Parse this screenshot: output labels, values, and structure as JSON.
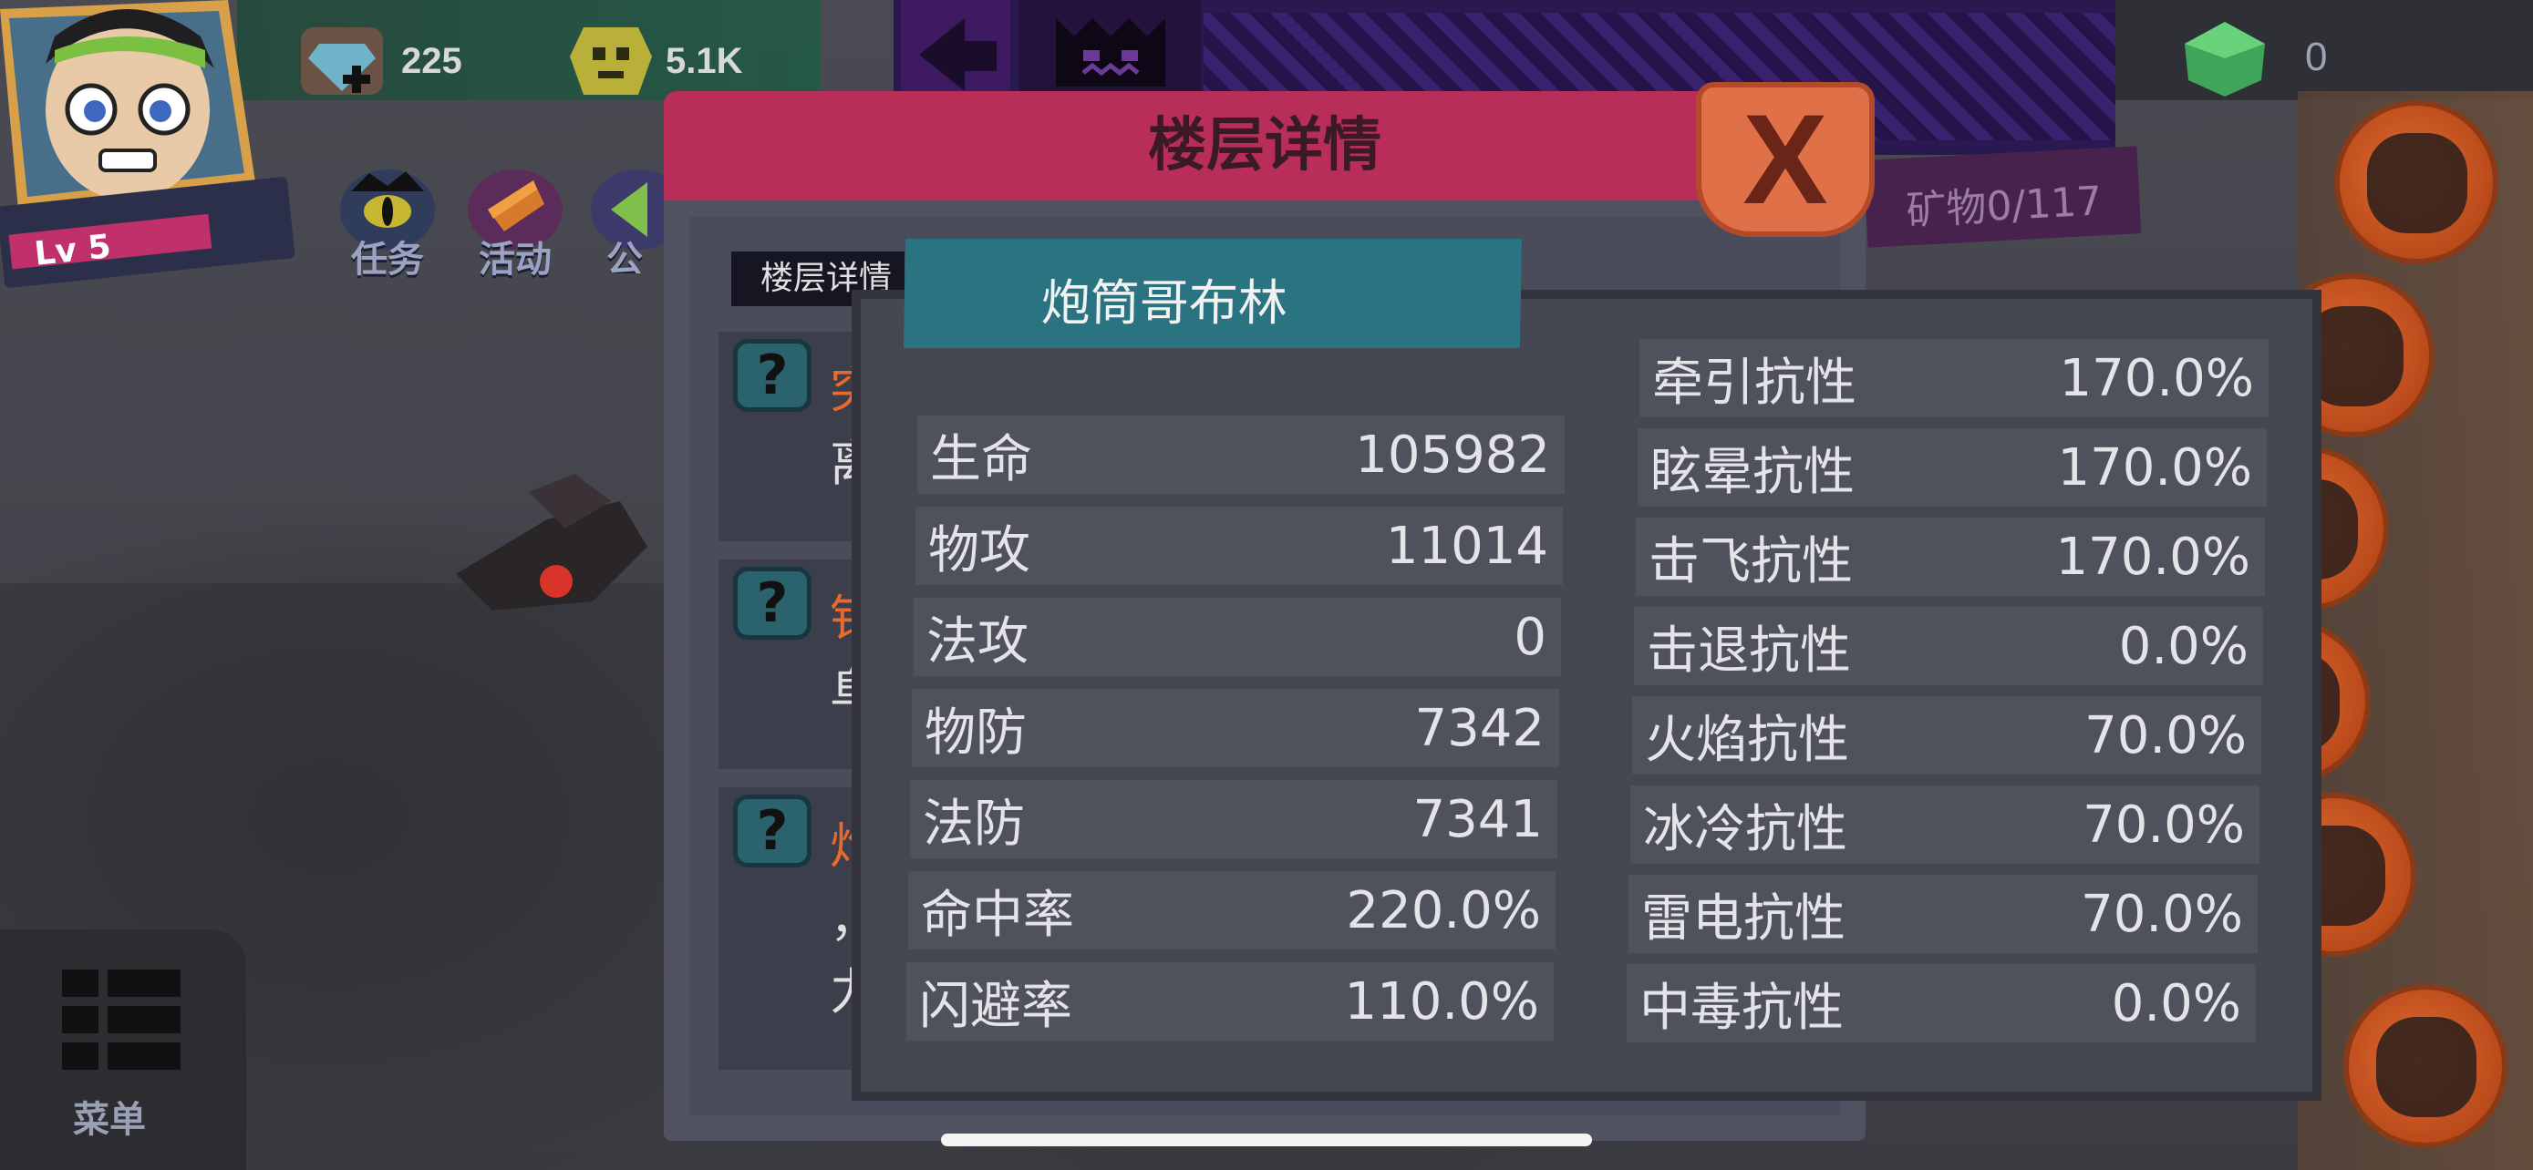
{
  "player": {
    "level": "Lv 5"
  },
  "currencies": {
    "diamonds": "225",
    "skull_coins": "5.1K",
    "gems": "0"
  },
  "quick_menu": [
    {
      "label": "任务"
    },
    {
      "label": "活动"
    },
    {
      "label": "公"
    }
  ],
  "menu": {
    "label": "菜单"
  },
  "mineral": "矿物0/117",
  "floor_panel": {
    "title": "楼层详情",
    "tab_label": "楼层详情",
    "entries": [
      {
        "title": "突",
        "text": "离"
      },
      {
        "title": "钐",
        "text": "阜"
      },
      {
        "title": "炮",
        "text": "，"
      }
    ],
    "entry_extra": "力"
  },
  "monster": {
    "name": "炮筒哥布林",
    "stats_left": [
      {
        "label": "生命",
        "value": "105982"
      },
      {
        "label": "物攻",
        "value": "11014"
      },
      {
        "label": "法攻",
        "value": "0"
      },
      {
        "label": "物防",
        "value": "7342"
      },
      {
        "label": "法防",
        "value": "7341"
      },
      {
        "label": "命中率",
        "value": "220.0%"
      },
      {
        "label": "闪避率",
        "value": "110.0%"
      }
    ],
    "stats_right": [
      {
        "label": "牵引抗性",
        "value": "170.0%"
      },
      {
        "label": "眩晕抗性",
        "value": "170.0%"
      },
      {
        "label": "击飞抗性",
        "value": "170.0%"
      },
      {
        "label": "击退抗性",
        "value": "0.0%"
      },
      {
        "label": "火焰抗性",
        "value": "70.0%"
      },
      {
        "label": "冰冷抗性",
        "value": "70.0%"
      },
      {
        "label": "雷电抗性",
        "value": "70.0%"
      },
      {
        "label": "中毒抗性",
        "value": "0.0%"
      }
    ]
  },
  "close_label": "X",
  "colors": {
    "floor_header": "#b82e58",
    "stats_title": "#2a7381",
    "close_button": "#e07048",
    "entry_title": "#e86a2d"
  }
}
